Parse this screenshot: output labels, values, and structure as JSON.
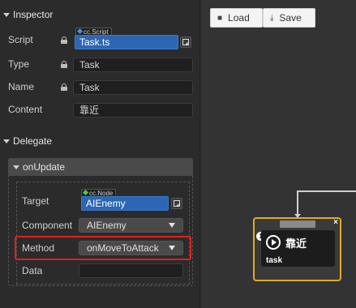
{
  "inspector": {
    "title": "Inspector",
    "script": {
      "label": "Script",
      "tag": "cc.Script",
      "value": "Task.ts"
    },
    "type": {
      "label": "Type",
      "value": "Task"
    },
    "name": {
      "label": "Name",
      "value": "Task"
    },
    "content": {
      "label": "Content",
      "value": "靠近"
    }
  },
  "delegate": {
    "title": "Delegate",
    "event": "onUpdate",
    "target": {
      "label": "Target",
      "tag": "cc.Node",
      "value": "AIEnemy"
    },
    "component": {
      "label": "Component",
      "value": "AIEnemy"
    },
    "method": {
      "label": "Method",
      "value": "onMoveToAttack"
    },
    "data": {
      "label": "Data",
      "value": ""
    }
  },
  "toolbar": {
    "load_label": "Load",
    "save_label": "Save"
  },
  "node": {
    "index": "1",
    "title": "靠近",
    "subtitle": "task",
    "close": "×"
  },
  "colors": {
    "accent_blue": "#2d66b2",
    "highlight_red": "#e02020",
    "node_border": "#e3a92b",
    "script_tag_dot": "#4f8fe0",
    "node_tag_dot": "#4ec94e"
  }
}
